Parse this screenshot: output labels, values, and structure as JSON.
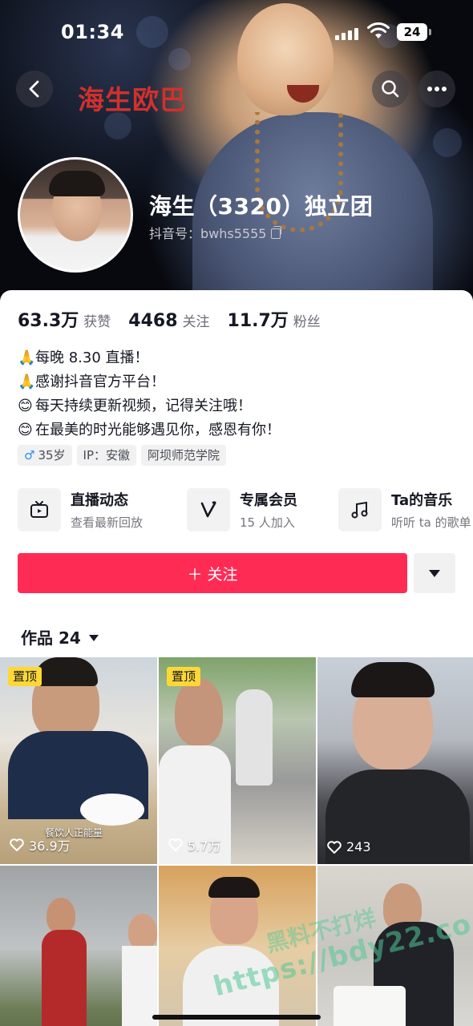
{
  "status_bar": {
    "time": "01:34",
    "battery": "24"
  },
  "cover": {
    "text": "海生欧巴"
  },
  "profile": {
    "name": "海生（3320）独立团",
    "douyin_id": "抖音号：bwhs5555"
  },
  "stats": [
    {
      "value": "63.3万",
      "label": "获赞"
    },
    {
      "value": "4468",
      "label": "关注"
    },
    {
      "value": "11.7万",
      "label": "粉丝"
    }
  ],
  "bio": [
    {
      "emoji": "🙏",
      "text": "每晚 8.30 直播！"
    },
    {
      "emoji": "🙏",
      "text": "感谢抖音官方平台！"
    },
    {
      "emoji": "😊",
      "text": "每天持续更新视频，记得关注哦！"
    },
    {
      "emoji": "😊",
      "text": "在最美的时光能够遇见你，感恩有你！"
    }
  ],
  "tags": {
    "gender_symbol": "♂",
    "age": "35岁",
    "ip": "IP：安徽",
    "school": "阿坝师范学院"
  },
  "features": [
    {
      "title": "直播动态",
      "subtitle": "查看最新回放",
      "icon": "tv-icon"
    },
    {
      "title": "专属会员",
      "subtitle": "15 人加入",
      "icon": "v-icon"
    },
    {
      "title": "Ta的音乐",
      "subtitle": "听听 ta 的歌单",
      "icon": "music-note-icon"
    }
  ],
  "follow_button": {
    "label": "＋ 关注"
  },
  "works_tab": {
    "label": "作品 24"
  },
  "videos": [
    {
      "pinned_label": "置顶",
      "likes": "36.9万",
      "overlay": "餐饮人正能量"
    },
    {
      "pinned_label": "置顶",
      "likes": "5.7万"
    },
    {
      "likes": "243"
    },
    {},
    {},
    {}
  ],
  "watermark": {
    "line1": "黑料不打烊",
    "line2": "https://bdy22.co"
  },
  "colors": {
    "accent": "#fe2c55",
    "pin_badge": "#fdd835",
    "cover_text": "#d0312d"
  }
}
